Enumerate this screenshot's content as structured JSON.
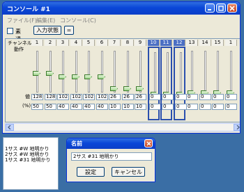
{
  "console": {
    "title": "コンソール #1",
    "menu": [
      "ファイル(F)",
      "編集(E)",
      "コンソール(C)"
    ],
    "toolbar": {
      "sudori_label": "素通り",
      "input_state_button": "入力状態",
      "equals_button": "="
    },
    "row_labels": {
      "channel": "チャンネル",
      "action": "動作",
      "value": "値",
      "percent": "(%)"
    },
    "channels": [
      {
        "num": "1",
        "value": "128",
        "percent": "50",
        "level": 0.5,
        "selected": false
      },
      {
        "num": "2",
        "value": "128",
        "percent": "50",
        "level": 0.5,
        "selected": false
      },
      {
        "num": "3",
        "value": "102",
        "percent": "40",
        "level": 0.4,
        "selected": false
      },
      {
        "num": "4",
        "value": "102",
        "percent": "40",
        "level": 0.4,
        "selected": false
      },
      {
        "num": "5",
        "value": "102",
        "percent": "40",
        "level": 0.4,
        "selected": false
      },
      {
        "num": "6",
        "value": "102",
        "percent": "40",
        "level": 0.4,
        "selected": false
      },
      {
        "num": "7",
        "value": "26",
        "percent": "10",
        "level": 0.1,
        "selected": false
      },
      {
        "num": "8",
        "value": "26",
        "percent": "10",
        "level": 0.1,
        "selected": false
      },
      {
        "num": "9",
        "value": "26",
        "percent": "10",
        "level": 0.1,
        "selected": false
      },
      {
        "num": "10",
        "value": "0",
        "percent": "0",
        "level": 0.0,
        "selected": true
      },
      {
        "num": "11",
        "value": "0",
        "percent": "0",
        "level": 0.0,
        "selected": true
      },
      {
        "num": "12",
        "value": "0",
        "percent": "0",
        "level": 0.0,
        "selected": true
      },
      {
        "num": "13",
        "value": "0",
        "percent": "0",
        "level": 0.0,
        "selected": false
      },
      {
        "num": "14",
        "value": "0",
        "percent": "0",
        "level": 0.0,
        "selected": false
      },
      {
        "num": "15",
        "value": "0",
        "percent": "0",
        "level": 0.0,
        "selected": false
      },
      {
        "num": "1",
        "value": "0",
        "percent": "0",
        "level": 0.0,
        "selected": false
      }
    ]
  },
  "list": {
    "items": [
      "1サス  #W  地明かり",
      "2サス  #W  地明かり",
      "1サス  #31  地明かり"
    ]
  },
  "name_dialog": {
    "title": "名前",
    "input_value": "2サス  #31  地明かり",
    "ok_button": "設定",
    "cancel_button": "キャンセル"
  },
  "colors": {
    "title_bar": "#0a46d8",
    "window_bg": "#ece9d8",
    "selected_column": "#2a4fae",
    "fader_thumb": "#9fd38c",
    "close_button": "#c4411e"
  }
}
